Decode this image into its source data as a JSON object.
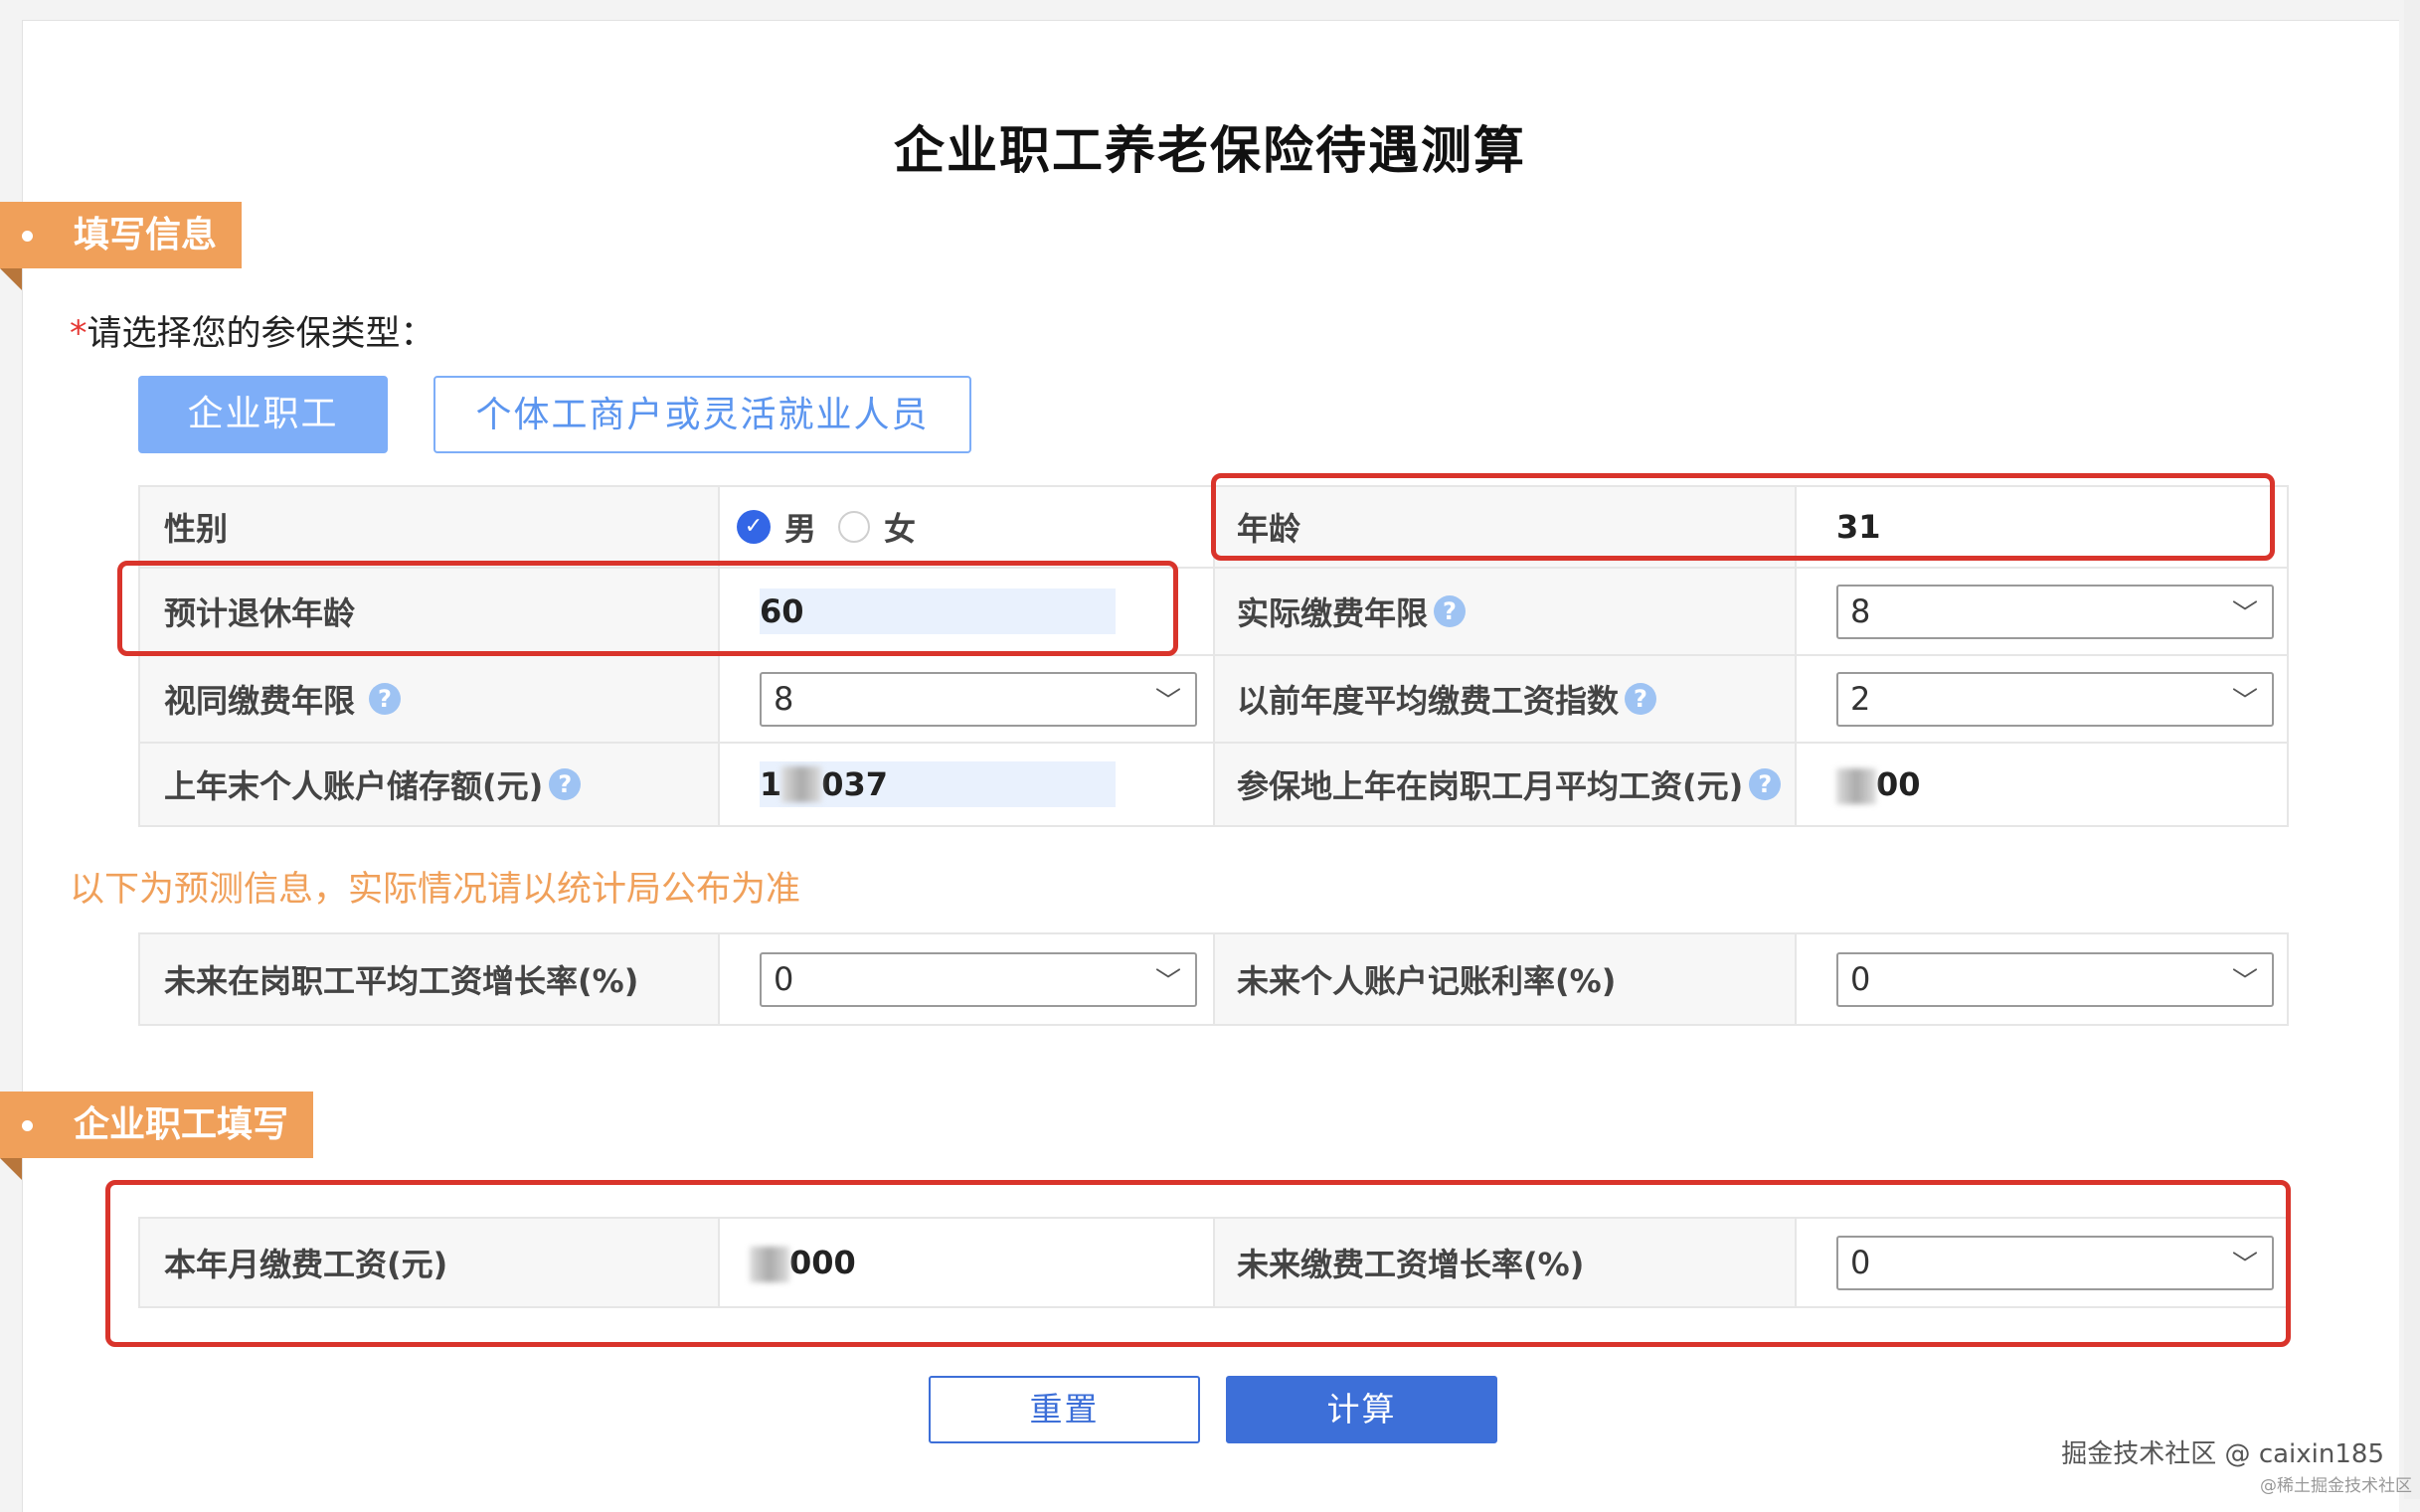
{
  "title": "企业职工养老保险待遇测算",
  "section_fill_info": "填写信息",
  "type_question": {
    "required_mark": "*",
    "text": "请选择您的参保类型："
  },
  "insurance_types": [
    "企业职工",
    "个体工商户或灵活就业人员"
  ],
  "form": {
    "gender_label": "性别",
    "gender_male": "男",
    "gender_female": "女",
    "age_label": "年龄",
    "age_value": "31",
    "retire_age_label": "预计退休年龄",
    "retire_age_value": "60",
    "actual_years_label": "实际缴费年限",
    "actual_years_value": "8",
    "deemed_years_label": "视同缴费年限",
    "deemed_years_value": "8",
    "avg_index_label": "以前年度平均缴费工资指数",
    "avg_index_value": "2",
    "account_balance_label": "上年末个人账户储存额(元)",
    "account_balance_prefix": "1",
    "account_balance_suffix": "037",
    "local_avg_wage_label": "参保地上年在岗职工月平均工资(元)",
    "local_avg_wage_suffix": "00"
  },
  "notice": "以下为预测信息，实际情况请以统计局公布为准",
  "prediction": {
    "wage_growth_label": "未来在岗职工平均工资增长率(%)",
    "wage_growth_value": "0",
    "account_rate_label": "未来个人账户记账利率(%)",
    "account_rate_value": "0"
  },
  "section_enterprise": "企业职工填写",
  "enterprise": {
    "monthly_wage_label": "本年月缴费工资(元)",
    "monthly_wage_suffix": "000",
    "future_growth_label": "未来缴费工资增长率(%)",
    "future_growth_value": "0"
  },
  "buttons": {
    "reset": "重置",
    "calculate": "计算"
  },
  "watermark": "掘金技术社区 @ caixin185",
  "watermark_small": "@稀土掘金技术社区",
  "icons": {
    "help": "question-icon",
    "select": "chevron-down-icon",
    "radio": "check-icon"
  },
  "colors": {
    "accent": "#3d6fd8",
    "orange": "#f0a05a",
    "highlight": "#d9342b"
  }
}
